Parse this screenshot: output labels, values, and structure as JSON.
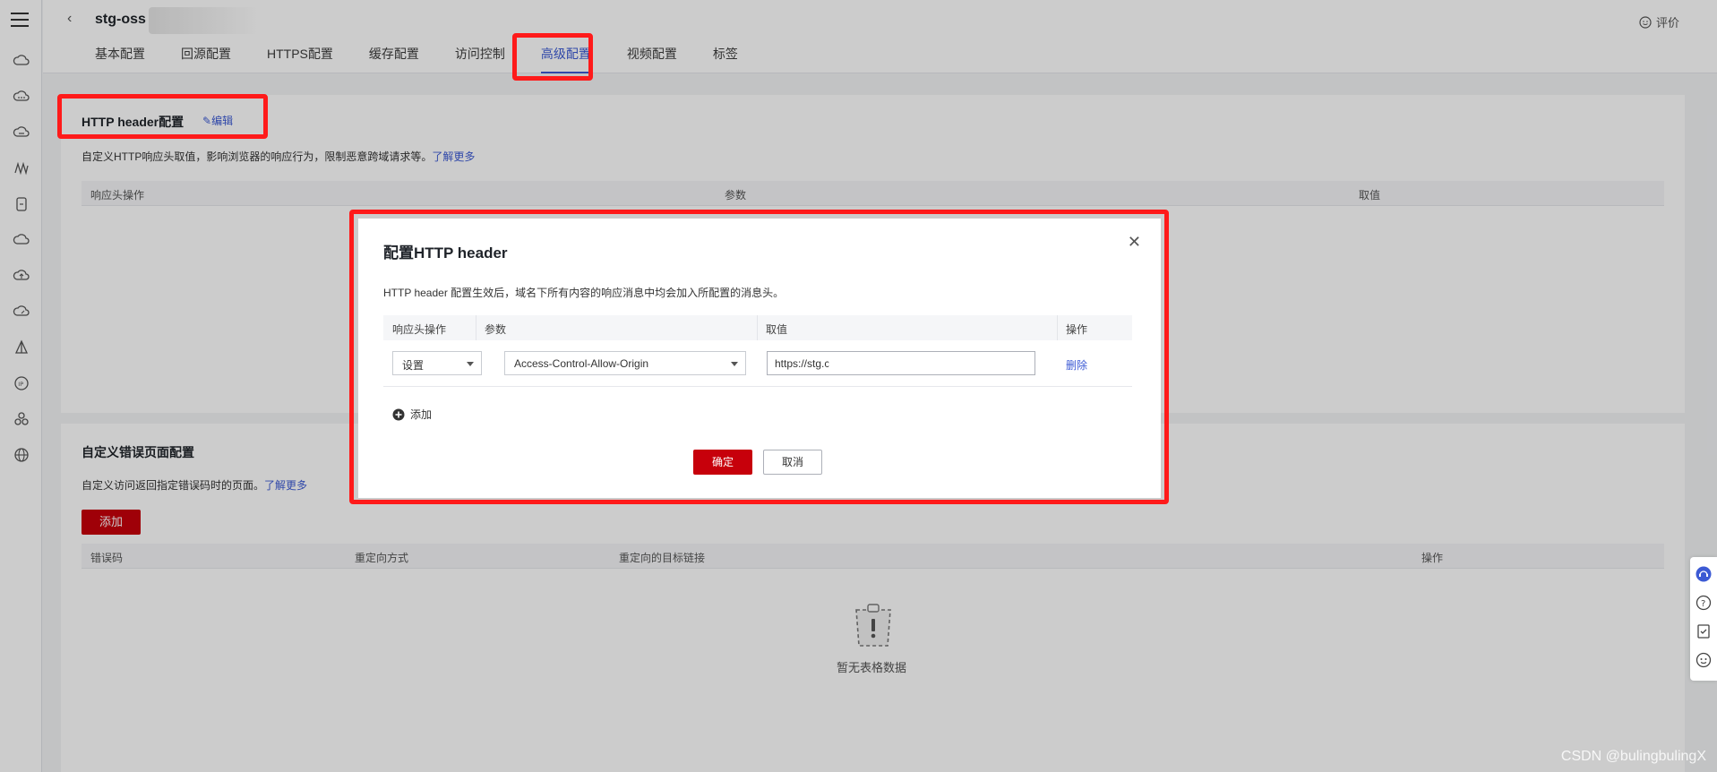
{
  "header": {
    "title": "stg-oss",
    "rate_label": "评价",
    "tabs": [
      "基本配置",
      "回源配置",
      "HTTPS配置",
      "缓存配置",
      "访问控制",
      "高级配置",
      "视频配置",
      "标签"
    ],
    "active_tab": "高级配置"
  },
  "http_header_section": {
    "title": "HTTP header配置",
    "edit_label": "编辑",
    "description": "自定义HTTP响应头取值，影响浏览器的响应行为，限制恶意跨域请求等。",
    "learn_more": "了解更多",
    "columns": [
      "响应头操作",
      "参数",
      "取值"
    ]
  },
  "error_page_section": {
    "title": "自定义错误页面配置",
    "description": "自定义访问返回指定错误码时的页面。",
    "learn_more": "了解更多",
    "add_label": "添加",
    "columns": [
      "错误码",
      "重定向方式",
      "重定向的目标链接",
      "操作"
    ],
    "empty_text": "暂无表格数据"
  },
  "dialog": {
    "title": "配置HTTP header",
    "description": "HTTP header 配置生效后，域名下所有内容的响应消息中均会加入所配置的消息头。",
    "columns": [
      "响应头操作",
      "参数",
      "取值",
      "操作"
    ],
    "row": {
      "action_value": "设置",
      "param_value": "Access-Control-Allow-Origin",
      "value_text": "https://stg.c",
      "delete_label": "删除"
    },
    "add_label": "添加",
    "ok_label": "确定",
    "cancel_label": "取消"
  },
  "watermark": "CSDN @bulingbulingX",
  "colors": {
    "accent": "#3c5ad4",
    "primary": "#c7000b",
    "highlight": "#ff1a1a"
  }
}
